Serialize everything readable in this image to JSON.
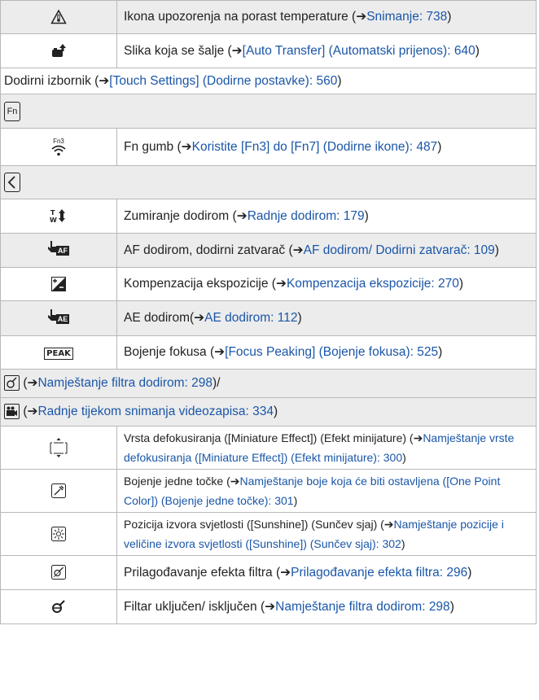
{
  "rows": [
    {
      "icon": "temperature-warning-icon",
      "pre": "Ikona upozorenja na porast temperature (",
      "link": "Snimanje: 738",
      "post": ")"
    },
    {
      "icon": "image-upload-icon",
      "pre": "Slika koja se šalje (",
      "link": "[Auto Transfer] (Automatski prijenos): 640",
      "post": ")"
    }
  ],
  "touch_menu": {
    "pre": "Dodirni izbornik (",
    "link": "[Touch Settings] (Dodirne postavke): 560",
    "post": ")"
  },
  "fn_section_icon_label": "Fn",
  "fn_row": {
    "icon_label": "Fn3",
    "pre": "Fn gumb (",
    "link": "Koristite [Fn3] do [Fn7] (Dodirne ikone): 487",
    "post": ")"
  },
  "tab_rows": [
    {
      "icon": "touch-zoom-icon",
      "pre": "Zumiranje dodirom (",
      "link": "Radnje dodirom: 179",
      "post": ")"
    },
    {
      "icon": "touch-af-icon",
      "icon_text": "AF",
      "pre": "AF dodirom, dodirni zatvarač (",
      "link": "AF dodirom/ Dodirni zatvarač: 109",
      "post": ")"
    },
    {
      "icon": "exposure-compensation-icon",
      "pre": "Kompenzacija ekspozicije (",
      "link": "Kompenzacija ekspozicije: 270",
      "post": ")"
    },
    {
      "icon": "touch-ae-icon",
      "icon_text": "AE",
      "pre": "AE dodirom(",
      "link": "AE dodirom: 112",
      "post": ")"
    },
    {
      "icon": "focus-peaking-icon",
      "icon_text": "PEAK",
      "pre": "Bojenje fokusa (",
      "link": "[Focus Peaking] (Bojenje fokusa): 525",
      "post": ")"
    }
  ],
  "filter_header": {
    "pre": "(",
    "link": "Namještanje filtra dodirom: 298",
    "post": ")/"
  },
  "video_header": {
    "pre": "(",
    "link": "Radnje tijekom snimanja videozapisa: 334",
    "post": ")"
  },
  "filter_rows": [
    {
      "icon": "defocus-type-icon",
      "pre": "Vrsta defokusiranja ([Miniature Effect]) (Efekt minijature) (",
      "link": "Namještanje vrste defokusiranja ([Miniature Effect]) (Efekt minijature): 300",
      "post": ")"
    },
    {
      "icon": "eyedropper-icon",
      "pre": "Bojenje jedne točke (",
      "link": "Namještanje boje koja će biti ostavljena ([One Point Color]) (Bojenje jedne točke): 301",
      "post": ")"
    },
    {
      "icon": "sunshine-icon",
      "pre": "Pozicija izvora svjetlosti ([Sunshine]) (Sunčev sjaj) (",
      "link": "Namještanje pozicije i veličine izvora svjetlosti ([Sunshine]) (Sunčev sjaj): 302",
      "post": ")"
    },
    {
      "icon": "filter-adjust-icon",
      "pre": "Prilagođavanje efekta filtra (",
      "link": "Prilagođavanje efekta filtra: 296",
      "post": ")"
    },
    {
      "icon": "filter-toggle-icon",
      "pre": "Filtar uključen/ isključen (",
      "link": "Namještanje filtra dodirom: 298",
      "post": ")"
    }
  ],
  "arrow": "➔"
}
